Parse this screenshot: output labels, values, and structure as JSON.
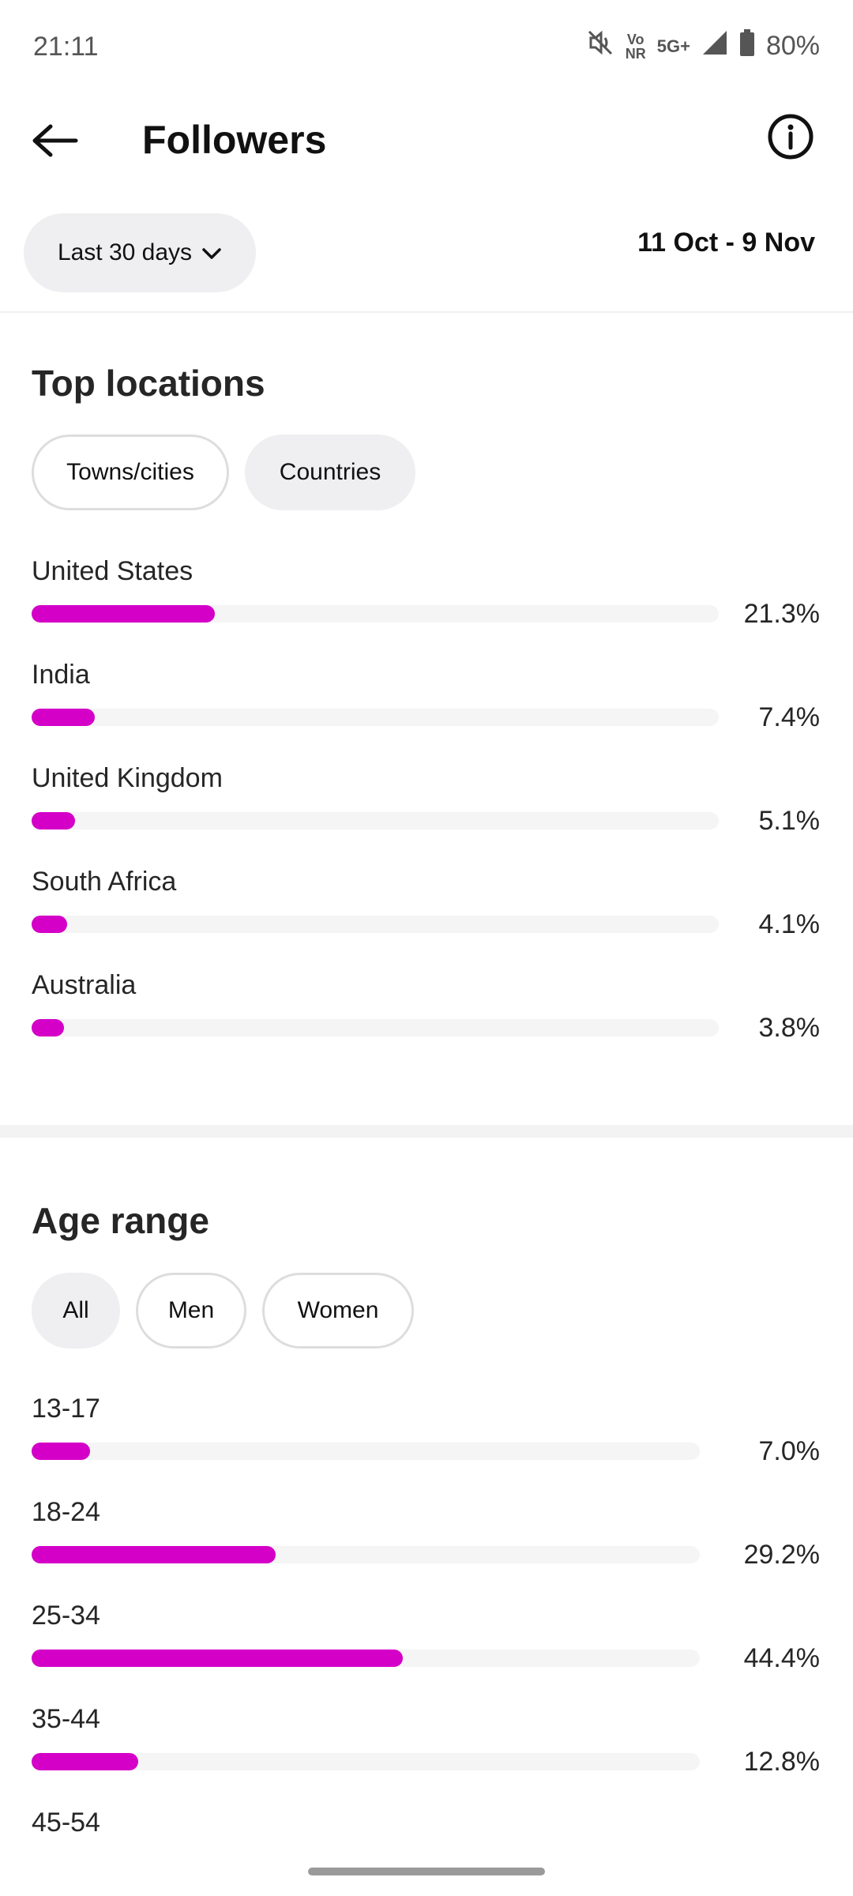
{
  "status_bar": {
    "time": "21:11",
    "network_top": "Vo",
    "network_bottom": "NR",
    "network_type": "5G+",
    "battery": "80%"
  },
  "header": {
    "title": "Followers"
  },
  "filters": {
    "range_label": "Last 30 days",
    "date_range": "11 Oct - 9 Nov"
  },
  "top_locations": {
    "title": "Top locations",
    "tabs": [
      {
        "label": "Towns/cities",
        "selected": false
      },
      {
        "label": "Countries",
        "selected": true
      }
    ],
    "items": [
      {
        "label": "United States",
        "value": "21.3%",
        "percent": 21.3
      },
      {
        "label": "India",
        "value": "7.4%",
        "percent": 7.4
      },
      {
        "label": "United Kingdom",
        "value": "5.1%",
        "percent": 5.1
      },
      {
        "label": "South Africa",
        "value": "4.1%",
        "percent": 4.1
      },
      {
        "label": "Australia",
        "value": "3.8%",
        "percent": 3.8
      }
    ]
  },
  "age_range": {
    "title": "Age range",
    "tabs": [
      {
        "label": "All",
        "selected": true
      },
      {
        "label": "Men",
        "selected": false
      },
      {
        "label": "Women",
        "selected": false
      }
    ],
    "items": [
      {
        "label": "13-17",
        "value": "7.0%",
        "percent": 7.0
      },
      {
        "label": "18-24",
        "value": "29.2%",
        "percent": 29.2
      },
      {
        "label": "25-34",
        "value": "44.4%",
        "percent": 44.4
      },
      {
        "label": "35-44",
        "value": "12.8%",
        "percent": 12.8
      },
      {
        "label": "45-54"
      }
    ]
  },
  "colors": {
    "bar_fill": "#d400c8",
    "bar_track": "#f5f5f6",
    "chip_bg": "#efeff1"
  },
  "icons": {
    "back": "arrow-left-icon",
    "info": "info-circle-icon",
    "dropdown": "chevron-down-icon",
    "mute": "vibrate-off-icon",
    "signal": "signal-icon",
    "battery": "battery-icon"
  }
}
